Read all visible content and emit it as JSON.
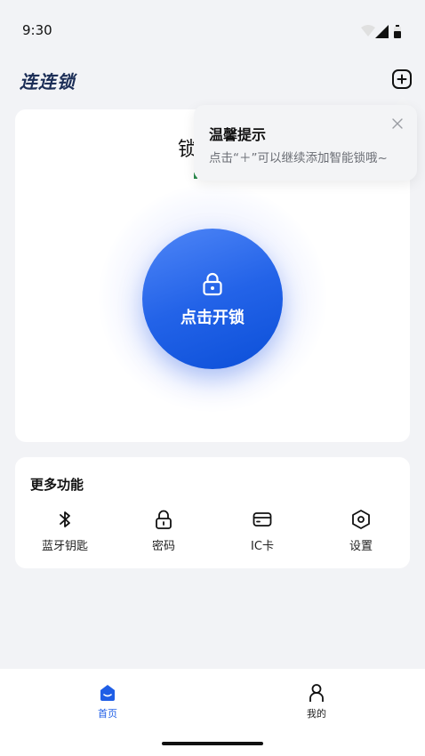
{
  "status_bar": {
    "time": "9:30",
    "icons": [
      "wifi-icon",
      "signal-icon",
      "battery-icon"
    ]
  },
  "header": {
    "title": "连连锁",
    "add_icon": "plus-square-icon"
  },
  "lock_card": {
    "lock_name": "锁",
    "unlock_label": "点击开锁",
    "unlock_icon": "lock-icon"
  },
  "tooltip": {
    "title": "温馨提示",
    "text": "点击“＋”可以继续添加智能锁哦~",
    "close_icon": "close-icon"
  },
  "more_functions": {
    "title": "更多功能",
    "items": [
      {
        "label": "蓝牙钥匙",
        "icon": "bluetooth-icon"
      },
      {
        "label": "密码",
        "icon": "lock-icon"
      },
      {
        "label": "IC卡",
        "icon": "card-icon"
      },
      {
        "label": "设置",
        "icon": "settings-hexagon-icon"
      }
    ]
  },
  "tabbar": {
    "tabs": [
      {
        "label": "首页",
        "icon": "home-icon",
        "active": true
      },
      {
        "label": "我的",
        "icon": "profile-icon",
        "active": false
      }
    ]
  },
  "colors": {
    "accent": "#1f5ee6",
    "title": "#1c2e57",
    "background": "#f2f3f6"
  }
}
